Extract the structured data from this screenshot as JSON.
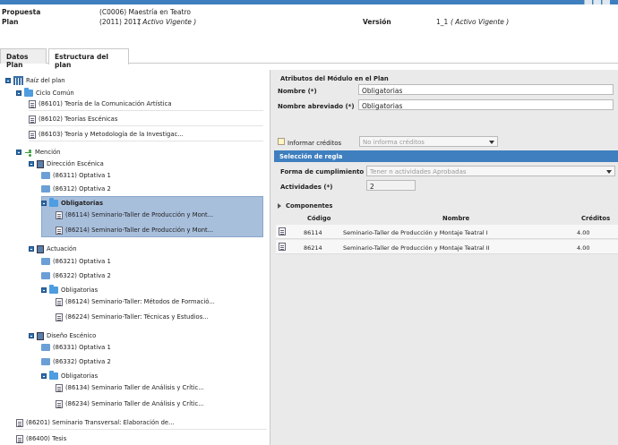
{
  "header": {
    "propuesta_label": "Propuesta",
    "propuesta_value": "(C0006) Maestría en Teatro",
    "plan_label": "Plan",
    "plan_value": "(2011) 2011",
    "plan_state": "( Activo Vigente )",
    "version_label": "Versión",
    "version_value": "1_1",
    "version_state": "( Activo Vigente )"
  },
  "tabs": [
    {
      "label": "Datos Plan"
    },
    {
      "label": "Estructura del plan"
    }
  ],
  "tree": {
    "root": "Raíz del plan",
    "ciclo": "Ciclo Común",
    "ciclo_items": [
      "(86101) Teoría de la Comunicación Artística",
      "(86102) Teorías Escénicas",
      "(86103) Teoría y Metodología de la Investigac..."
    ],
    "mencion": "Mención",
    "direccion": "Dirección Escénica",
    "direccion_items": [
      "(86311) Optativa 1",
      "(86312) Optativa 2"
    ],
    "direccion_oblig": "Obligatorias",
    "direccion_oblig_items": [
      "(86114) Seminario-Taller de Producción y Mont...",
      "(86214) Seminario-Taller de Producción y Mont..."
    ],
    "actuacion": "Actuación",
    "actuacion_items": [
      "(86321) Optativa 1",
      "(86322) Optativa 2"
    ],
    "actuacion_oblig": "Obligatorias",
    "actuacion_oblig_items": [
      "(86124) Seminario-Taller: Métodos de Formació...",
      "(86224) Seminario-Taller: Técnicas y Estudios..."
    ],
    "diseno": "Diseño Escénico",
    "diseno_items": [
      "(86331) Optativa 1",
      "(86332) Optativa 2"
    ],
    "diseno_oblig": "Obligatorias",
    "diseno_oblig_items": [
      "(86134) Seminario Taller de Análisis y Crític...",
      "(86234) Seminario Taller de Análisis y Crític..."
    ],
    "extra_items": [
      "(86201) Seminario Transversal: Elaboración de...",
      "(86400) Tesis"
    ]
  },
  "panel": {
    "title": "Atributos del Módulo en el Plan",
    "nombre_label": "Nombre (*)",
    "nombre_value": "Obligatorias",
    "abrev_label": "Nombre abreviado (*)",
    "abrev_value": "Obligatorias",
    "creditos_label": "Informar créditos",
    "creditos_value": "No informa créditos",
    "regla_title": "Selección de regla",
    "forma_label": "Forma de cumplimiento (*)",
    "forma_value": "Tener n actividades Aprobadas",
    "actividades_label": "Actividades (*)",
    "actividades_value": "2",
    "componentes_title": "Componentes",
    "columns": {
      "codigo": "Código",
      "nombre": "Nombre",
      "creditos": "Créditos"
    },
    "rows": [
      {
        "codigo": "86114",
        "nombre": "Seminario-Taller de Producción y Montaje Teatral I",
        "creditos": "4.00"
      },
      {
        "codigo": "86214",
        "nombre": "Seminario-Taller de Producción y Montaje Teatral II",
        "creditos": "4.00"
      }
    ]
  },
  "colors": {
    "accent": "#3f7fbf",
    "selection": "#a8bfdc",
    "panel_bg": "#eaeaea"
  }
}
